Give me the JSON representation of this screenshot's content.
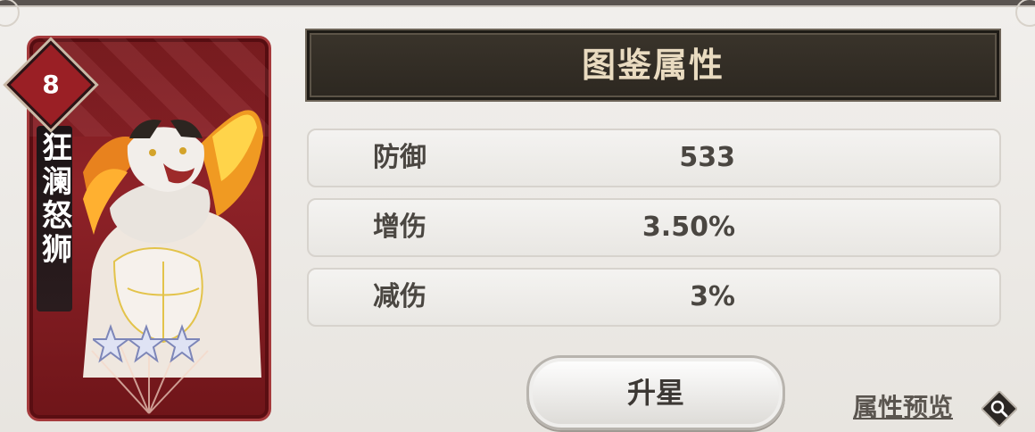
{
  "card": {
    "level": "8",
    "name_chars": [
      "狂",
      "澜",
      "怒",
      "狮"
    ],
    "stars": 3
  },
  "header": {
    "title": "图鉴属性"
  },
  "stats": [
    {
      "label": "防御",
      "value": "533"
    },
    {
      "label": "增伤",
      "value": "3.50%"
    },
    {
      "label": "减伤",
      "value": "3%"
    }
  ],
  "actions": {
    "upgrade_label": "升星",
    "preview_label": "属性预览"
  },
  "colors": {
    "card_red": "#8e2228",
    "header_dark": "#2c2720",
    "header_text": "#e9dbc0",
    "row_bg": "#f1f0ee"
  },
  "icons": {
    "preview": "magnifier-icon",
    "star": "star-icon"
  }
}
